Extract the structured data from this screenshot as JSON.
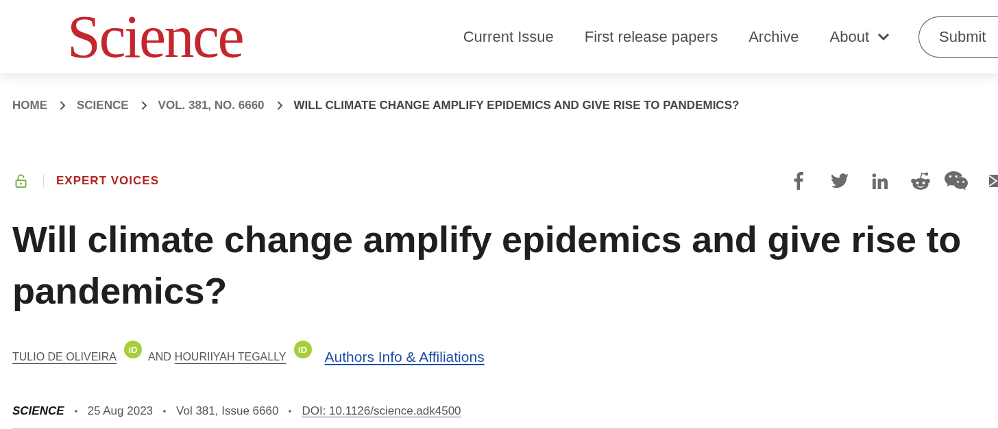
{
  "header": {
    "logo": "Science",
    "nav": [
      {
        "label": "Current Issue",
        "kind": "link"
      },
      {
        "label": "First release papers",
        "kind": "link"
      },
      {
        "label": "Archive",
        "kind": "link"
      },
      {
        "label": "About",
        "kind": "dropdown"
      }
    ],
    "submit_button": "Submit"
  },
  "breadcrumb": [
    {
      "label": "HOME",
      "current": false
    },
    {
      "label": "SCIENCE",
      "current": false
    },
    {
      "label": "VOL. 381, NO. 6660",
      "current": false
    },
    {
      "label": "WILL CLIMATE CHANGE AMPLIFY EPIDEMICS AND GIVE RISE TO PANDEMICS?",
      "current": true
    }
  ],
  "article": {
    "free_access": true,
    "section": "EXPERT VOICES",
    "title": "Will climate change amplify epidemics and give rise to pandemics?",
    "authors": [
      {
        "name": "TULIO DE OLIVEIRA",
        "orcid_badge": "iD"
      },
      {
        "name": "HOURIIYAH TEGALLY",
        "orcid_badge": "iD"
      }
    ],
    "author_joiner": "AND",
    "authors_link": "Authors Info & Affiliations",
    "journal": "SCIENCE",
    "date": "25 Aug 2023",
    "issue": "Vol 381, Issue 6660",
    "doi": "DOI: 10.1126/science.adk4500"
  }
}
